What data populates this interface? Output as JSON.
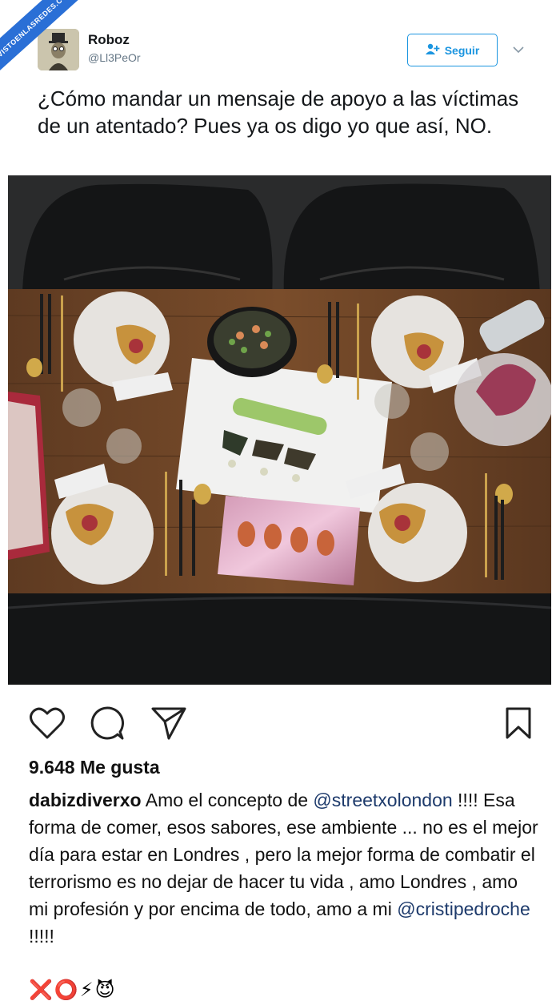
{
  "watermark": {
    "text": "VISTOENLASREDES.COM"
  },
  "tweet": {
    "author_name": "Roboz",
    "author_handle": "@Ll3PeOr",
    "follow_label": "Seguir",
    "text": "¿Cómo mandar un mensaje de apoyo a las víctimas de un atentado? Pues ya os digo yo que así, NO."
  },
  "instagram": {
    "likes_label": "9.648 Me gusta",
    "caption": {
      "username": "dabizdiverxo",
      "part1": " Amo el concepto de ",
      "mention1": "@streetxolondon",
      "part2": " !!!! Esa forma de comer, esos sabores, ese ambiente ... no es  el mejor día para estar en Londres , pero la mejor forma de combatir el terrorismo es no dejar de hacer tu vida , amo Londres , amo mi profesión y por encima de todo, amo a mi ",
      "mention2": "@cristipedroche",
      "part3": " !!!!!"
    },
    "emojis": "❌⭕⚡😈"
  },
  "icons": [
    "heart-icon",
    "comment-icon",
    "share-icon",
    "bookmark-icon",
    "chevron-down-icon",
    "add-user-icon"
  ],
  "colors": {
    "twitter_blue": "#1b95e0",
    "mention": "#1d3a6b"
  }
}
